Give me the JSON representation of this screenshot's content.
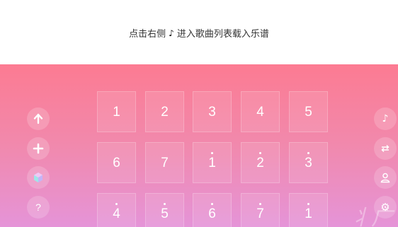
{
  "header": {
    "hint_before": "点击右侧",
    "hint_after": "进入歌曲列表载入乐谱",
    "note_icon": "music-note-icon"
  },
  "left_sidebar": [
    {
      "name": "arrow-up-icon"
    },
    {
      "name": "plus-icon"
    },
    {
      "name": "hexagon-icon"
    },
    {
      "name": "help-icon",
      "label": "?"
    }
  ],
  "right_sidebar": [
    {
      "name": "music-note-icon"
    },
    {
      "name": "repeat-icon"
    },
    {
      "name": "user-icon"
    },
    {
      "name": "gear-icon"
    }
  ],
  "keys": [
    {
      "label": "1",
      "dot": "none"
    },
    {
      "label": "2",
      "dot": "none"
    },
    {
      "label": "3",
      "dot": "none"
    },
    {
      "label": "4",
      "dot": "none"
    },
    {
      "label": "5",
      "dot": "none"
    },
    {
      "label": "6",
      "dot": "none"
    },
    {
      "label": "7",
      "dot": "none"
    },
    {
      "label": "1",
      "dot": "top"
    },
    {
      "label": "2",
      "dot": "top"
    },
    {
      "label": "3",
      "dot": "top"
    },
    {
      "label": "4",
      "dot": "top"
    },
    {
      "label": "5",
      "dot": "top"
    },
    {
      "label": "6",
      "dot": "top"
    },
    {
      "label": "7",
      "dot": "top"
    },
    {
      "label": "1",
      "dot": "top"
    }
  ],
  "colors": {
    "gradient_top": "#fc7b92",
    "gradient_bottom": "#e594d8"
  }
}
